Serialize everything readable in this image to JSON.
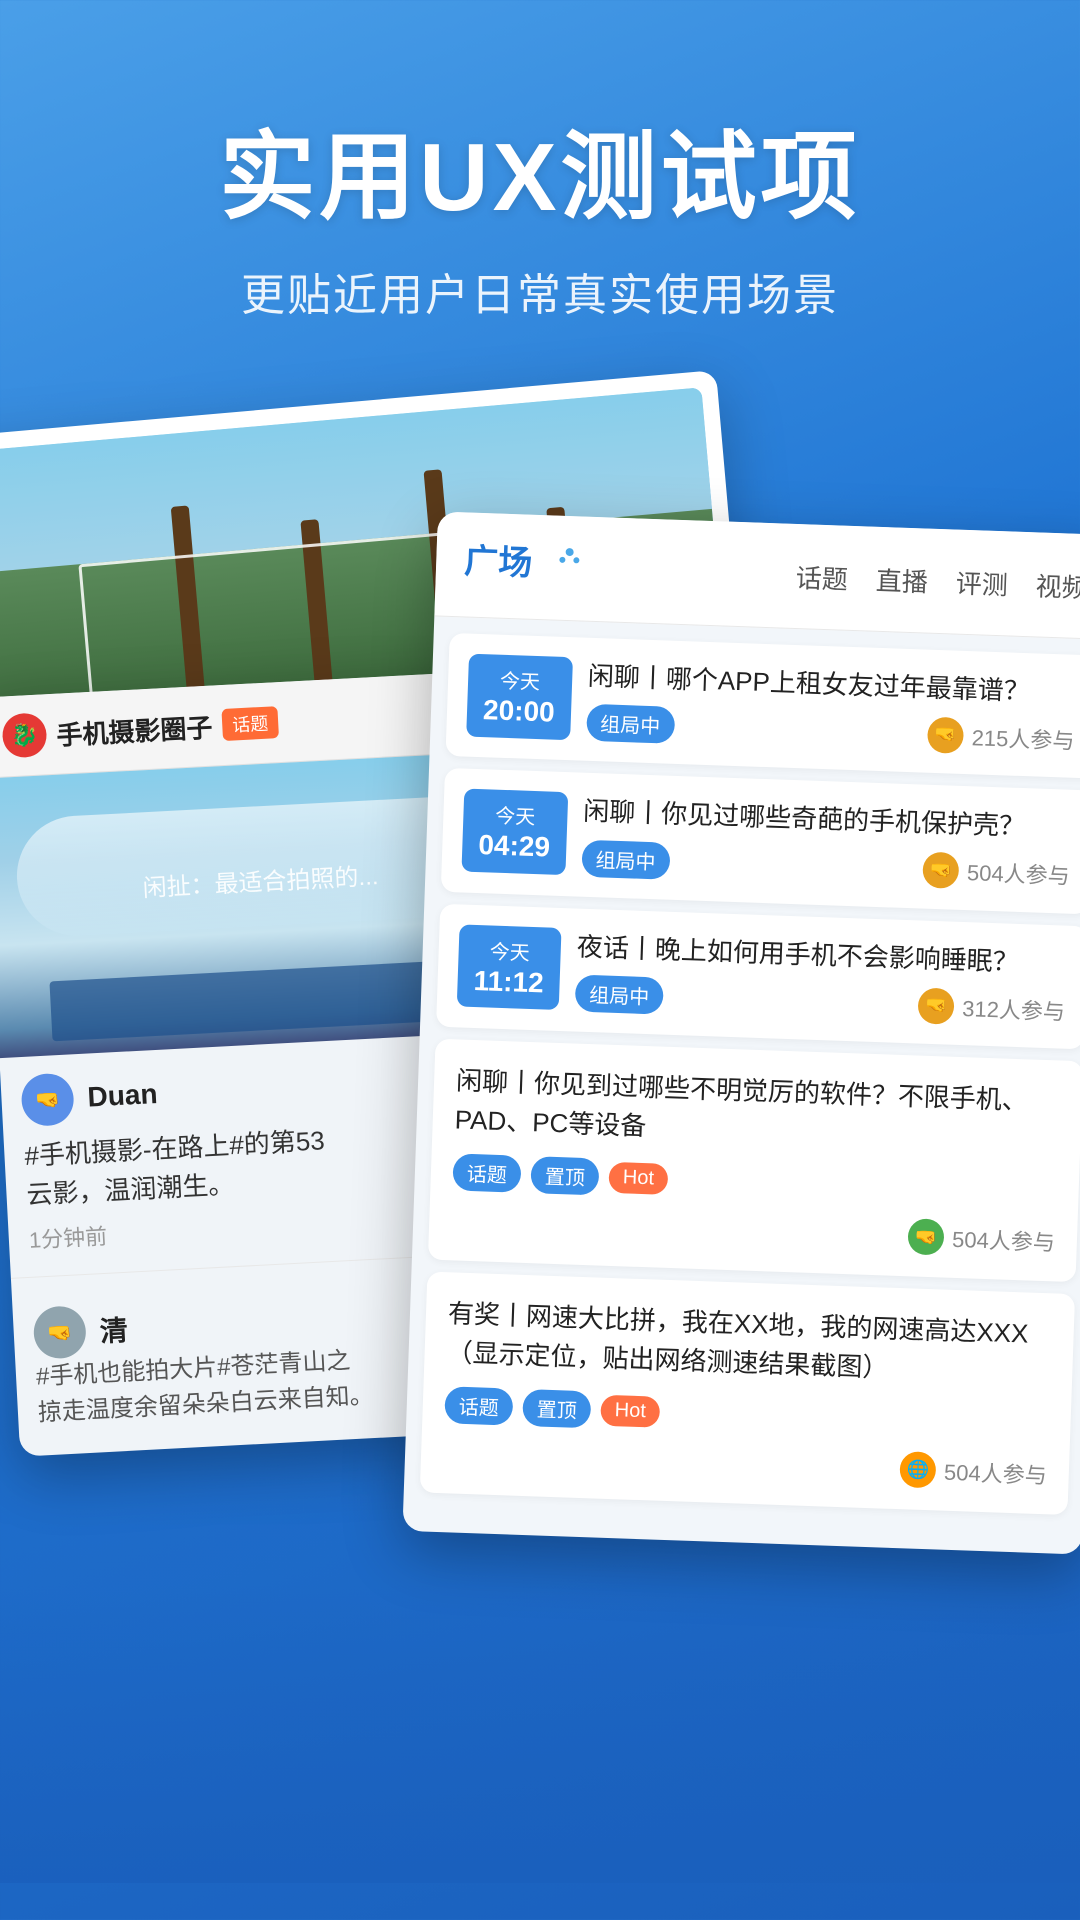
{
  "header": {
    "main_title": "实用UX测试项",
    "sub_title": "更贴近用户日常真实使用场景"
  },
  "photo_card": {
    "alt": "outdoor photo with trees and water"
  },
  "phone_photo_card": {
    "channel_name": "手机摄影圈子",
    "channel_tag": "话题",
    "post1": {
      "user_name": "Duan",
      "text": "#手机摄影-在路上#的第53\n云影，温润潮生。",
      "time": "1分钟前"
    },
    "post2": {
      "user_name": "清",
      "text": "#手机也能拍大片#苍茫青山之\n掠走温度余留朵朵白云来自知。"
    }
  },
  "forum_card": {
    "logo": "广场",
    "nav": [
      "话题",
      "直播",
      "评测",
      "视频"
    ],
    "items": [
      {
        "time_today": "今天",
        "time_clock": "20:00",
        "title": "闲聊丨哪个APP上租女友过年最靠谱？",
        "status": "组局中",
        "participants": "215人参与"
      },
      {
        "time_today": "今天",
        "time_clock": "04:29",
        "title": "闲聊丨你见过哪些奇葩的手机保护壳？",
        "status": "组局中",
        "participants": "504人参与"
      },
      {
        "time_today": "今天",
        "time_clock": "11:12",
        "title": "夜话丨晚上如何用手机不会影响睡眠？",
        "status": "组局中",
        "participants": "312人参与"
      }
    ],
    "plain_items": [
      {
        "title": "闲聊丨你见到过哪些不明觉厉的软件？不限手机、PAD、PC等设备",
        "tags": [
          "话题",
          "置顶",
          "Hot"
        ],
        "participants": "504人参与"
      },
      {
        "title": "有奖丨网速大比拼，我在XX地，我的网速高达XXX（显示定位，贴出网络测速结果截图）",
        "tags": [
          "话题",
          "置顶",
          "Hot"
        ],
        "participants": "504人参与"
      }
    ]
  }
}
